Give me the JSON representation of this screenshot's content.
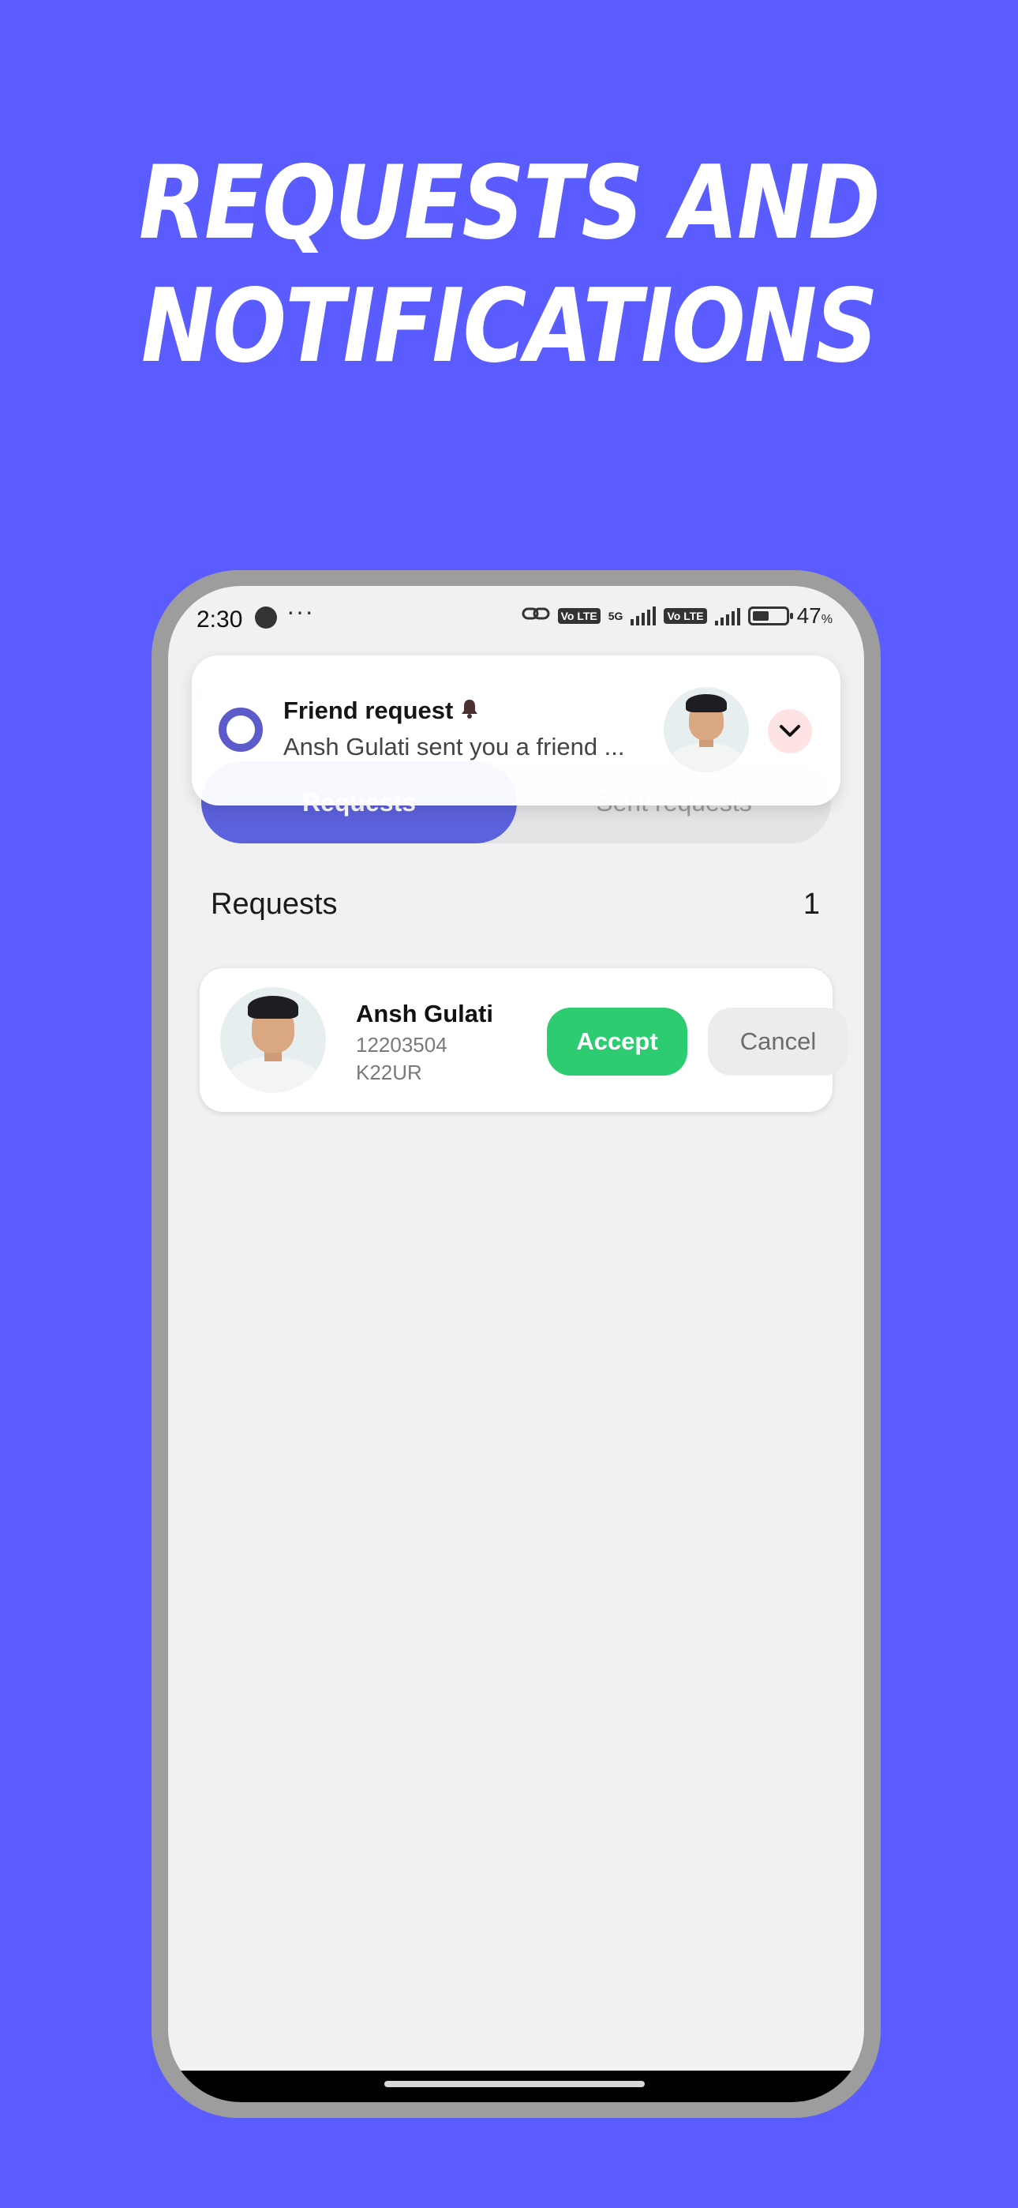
{
  "headline": {
    "line1": "REQUESTS AND",
    "line2": "NOTIFICATIONS"
  },
  "status_bar": {
    "time": "2:30",
    "more": "···",
    "network_chip_1": "Vo LTE",
    "network_label": "5G",
    "network_chip_2": "Vo LTE",
    "battery_percent": "47",
    "battery_unit": "%"
  },
  "app": {
    "header_title": "Requests",
    "tabs": [
      {
        "label": "Requests",
        "active": true
      },
      {
        "label": "Sent requests",
        "active": false
      }
    ],
    "section_title": "Requests",
    "section_count": "1",
    "requests": [
      {
        "name": "Ansh Gulati",
        "id": "12203504",
        "section": "K22UR",
        "accept_label": "Accept",
        "cancel_label": "Cancel"
      }
    ]
  },
  "notification": {
    "title": "Friend request",
    "body": "Ansh Gulati sent you a friend ...",
    "icons": {
      "app": "ring-icon",
      "bell": "bell-icon",
      "expand": "chevron-down-icon"
    }
  },
  "colors": {
    "background": "#5a5cff",
    "tab_active": "#5c61dc",
    "accept": "#2ecc71",
    "notif_ring": "#5b5bcc"
  }
}
